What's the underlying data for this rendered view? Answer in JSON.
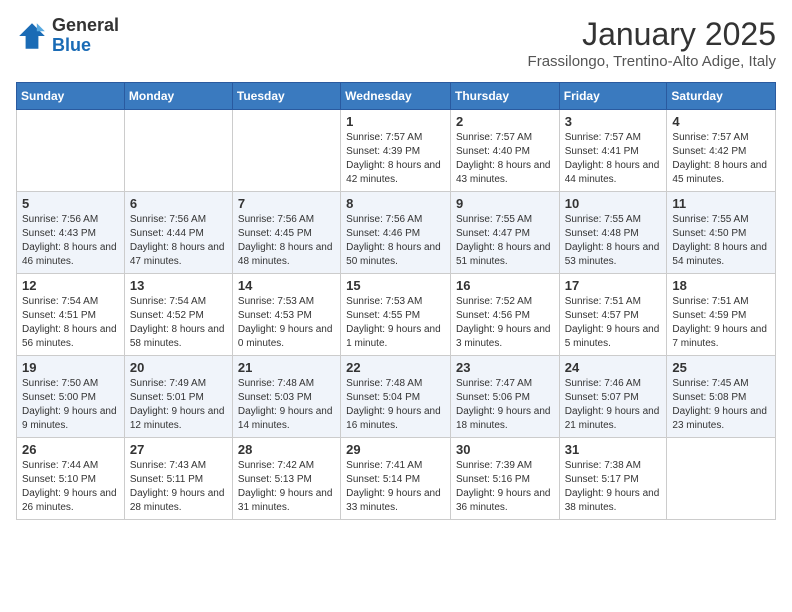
{
  "header": {
    "logo_general": "General",
    "logo_blue": "Blue",
    "title": "January 2025",
    "subtitle": "Frassilongo, Trentino-Alto Adige, Italy"
  },
  "calendar": {
    "days_of_week": [
      "Sunday",
      "Monday",
      "Tuesday",
      "Wednesday",
      "Thursday",
      "Friday",
      "Saturday"
    ],
    "weeks": [
      [
        {
          "day": "",
          "info": ""
        },
        {
          "day": "",
          "info": ""
        },
        {
          "day": "",
          "info": ""
        },
        {
          "day": "1",
          "info": "Sunrise: 7:57 AM\nSunset: 4:39 PM\nDaylight: 8 hours and 42 minutes."
        },
        {
          "day": "2",
          "info": "Sunrise: 7:57 AM\nSunset: 4:40 PM\nDaylight: 8 hours and 43 minutes."
        },
        {
          "day": "3",
          "info": "Sunrise: 7:57 AM\nSunset: 4:41 PM\nDaylight: 8 hours and 44 minutes."
        },
        {
          "day": "4",
          "info": "Sunrise: 7:57 AM\nSunset: 4:42 PM\nDaylight: 8 hours and 45 minutes."
        }
      ],
      [
        {
          "day": "5",
          "info": "Sunrise: 7:56 AM\nSunset: 4:43 PM\nDaylight: 8 hours and 46 minutes."
        },
        {
          "day": "6",
          "info": "Sunrise: 7:56 AM\nSunset: 4:44 PM\nDaylight: 8 hours and 47 minutes."
        },
        {
          "day": "7",
          "info": "Sunrise: 7:56 AM\nSunset: 4:45 PM\nDaylight: 8 hours and 48 minutes."
        },
        {
          "day": "8",
          "info": "Sunrise: 7:56 AM\nSunset: 4:46 PM\nDaylight: 8 hours and 50 minutes."
        },
        {
          "day": "9",
          "info": "Sunrise: 7:55 AM\nSunset: 4:47 PM\nDaylight: 8 hours and 51 minutes."
        },
        {
          "day": "10",
          "info": "Sunrise: 7:55 AM\nSunset: 4:48 PM\nDaylight: 8 hours and 53 minutes."
        },
        {
          "day": "11",
          "info": "Sunrise: 7:55 AM\nSunset: 4:50 PM\nDaylight: 8 hours and 54 minutes."
        }
      ],
      [
        {
          "day": "12",
          "info": "Sunrise: 7:54 AM\nSunset: 4:51 PM\nDaylight: 8 hours and 56 minutes."
        },
        {
          "day": "13",
          "info": "Sunrise: 7:54 AM\nSunset: 4:52 PM\nDaylight: 8 hours and 58 minutes."
        },
        {
          "day": "14",
          "info": "Sunrise: 7:53 AM\nSunset: 4:53 PM\nDaylight: 9 hours and 0 minutes."
        },
        {
          "day": "15",
          "info": "Sunrise: 7:53 AM\nSunset: 4:55 PM\nDaylight: 9 hours and 1 minute."
        },
        {
          "day": "16",
          "info": "Sunrise: 7:52 AM\nSunset: 4:56 PM\nDaylight: 9 hours and 3 minutes."
        },
        {
          "day": "17",
          "info": "Sunrise: 7:51 AM\nSunset: 4:57 PM\nDaylight: 9 hours and 5 minutes."
        },
        {
          "day": "18",
          "info": "Sunrise: 7:51 AM\nSunset: 4:59 PM\nDaylight: 9 hours and 7 minutes."
        }
      ],
      [
        {
          "day": "19",
          "info": "Sunrise: 7:50 AM\nSunset: 5:00 PM\nDaylight: 9 hours and 9 minutes."
        },
        {
          "day": "20",
          "info": "Sunrise: 7:49 AM\nSunset: 5:01 PM\nDaylight: 9 hours and 12 minutes."
        },
        {
          "day": "21",
          "info": "Sunrise: 7:48 AM\nSunset: 5:03 PM\nDaylight: 9 hours and 14 minutes."
        },
        {
          "day": "22",
          "info": "Sunrise: 7:48 AM\nSunset: 5:04 PM\nDaylight: 9 hours and 16 minutes."
        },
        {
          "day": "23",
          "info": "Sunrise: 7:47 AM\nSunset: 5:06 PM\nDaylight: 9 hours and 18 minutes."
        },
        {
          "day": "24",
          "info": "Sunrise: 7:46 AM\nSunset: 5:07 PM\nDaylight: 9 hours and 21 minutes."
        },
        {
          "day": "25",
          "info": "Sunrise: 7:45 AM\nSunset: 5:08 PM\nDaylight: 9 hours and 23 minutes."
        }
      ],
      [
        {
          "day": "26",
          "info": "Sunrise: 7:44 AM\nSunset: 5:10 PM\nDaylight: 9 hours and 26 minutes."
        },
        {
          "day": "27",
          "info": "Sunrise: 7:43 AM\nSunset: 5:11 PM\nDaylight: 9 hours and 28 minutes."
        },
        {
          "day": "28",
          "info": "Sunrise: 7:42 AM\nSunset: 5:13 PM\nDaylight: 9 hours and 31 minutes."
        },
        {
          "day": "29",
          "info": "Sunrise: 7:41 AM\nSunset: 5:14 PM\nDaylight: 9 hours and 33 minutes."
        },
        {
          "day": "30",
          "info": "Sunrise: 7:39 AM\nSunset: 5:16 PM\nDaylight: 9 hours and 36 minutes."
        },
        {
          "day": "31",
          "info": "Sunrise: 7:38 AM\nSunset: 5:17 PM\nDaylight: 9 hours and 38 minutes."
        },
        {
          "day": "",
          "info": ""
        }
      ]
    ]
  }
}
